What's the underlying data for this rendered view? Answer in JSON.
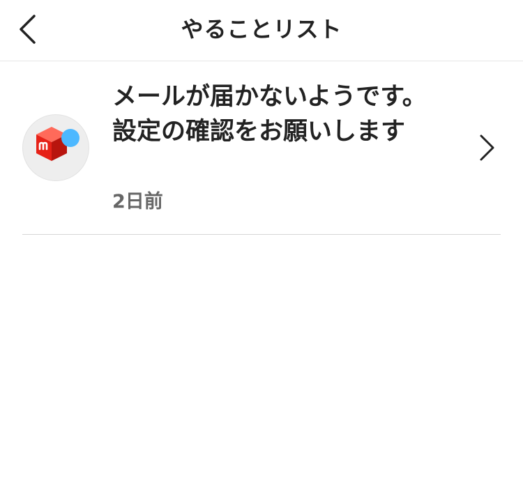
{
  "header": {
    "title": "やることリスト",
    "back_icon": "chevron-left-icon"
  },
  "todo_items": [
    {
      "avatar_icon": "mercari-logo-icon",
      "unread": true,
      "unread_color": "#4db8ff",
      "message": "メールが届かないようです。設定の確認をお願いします",
      "time": "2日前",
      "arrow_icon": "chevron-right-icon"
    }
  ],
  "colors": {
    "brand_red": "#e62117",
    "text": "#222222",
    "muted": "#666666"
  }
}
